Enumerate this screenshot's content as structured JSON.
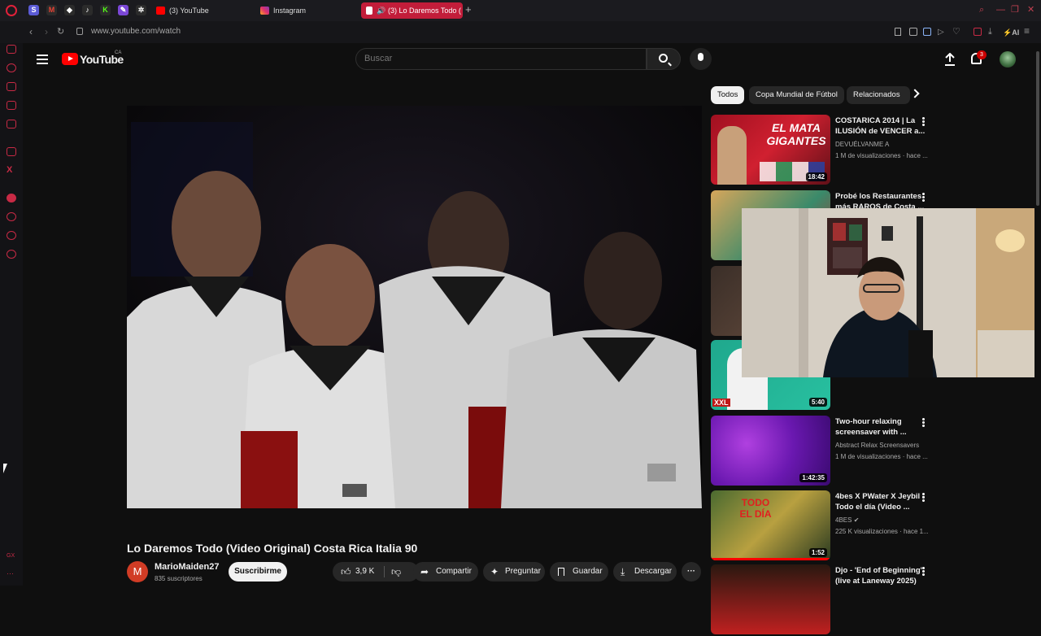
{
  "browser": {
    "tabs": [
      {
        "label": "(3) YouTube",
        "active": false
      },
      {
        "label": "Instagram",
        "active": false
      },
      {
        "label": "(3) Lo Daremos Todo (",
        "active": true
      }
    ],
    "url": "www.youtube.com/watch",
    "brand_color": "#c21d3a"
  },
  "header": {
    "logo_text": "YouTube",
    "region": "CA",
    "search_placeholder": "Buscar",
    "notification_count": "3"
  },
  "video": {
    "title": "Lo Daremos Todo (Video Original) Costa Rica Italia 90",
    "channel": {
      "avatar_letter": "M",
      "name": "MarioMaiden27",
      "subscribers": "835 suscriptores"
    },
    "subscribe_label": "Suscribirme",
    "like_count": "3,9 K",
    "actions": {
      "share": "Compartir",
      "ask": "Preguntar",
      "save": "Guardar",
      "download": "Descargar"
    }
  },
  "chips": [
    "Todos",
    "Copa Mundial de Fútbol",
    "Relacionados"
  ],
  "recommendations": [
    {
      "title": "COSTARICA 2014 | La ILUSIÓN de VENCER a...",
      "channel": "DEVUÉLVANME A",
      "meta": "1 M de visualizaciones · hace ...",
      "duration": "18:42",
      "thumb_text": "EL MATA GIGANTES"
    },
    {
      "title": "Probé los Restaurantes más RAROS de Costa ...",
      "channel": "",
      "meta": "",
      "duration": ""
    },
    {
      "title": "",
      "channel": "",
      "meta": "",
      "duration": ""
    },
    {
      "title": "",
      "channel": "",
      "meta": "",
      "duration": "5:40",
      "thumb_text": "XXL"
    },
    {
      "title": "Two-hour relaxing screensaver with ...",
      "channel": "Abstract Relax Screensavers",
      "meta": "1 M de visualizaciones · hace ...",
      "duration": "1:42:35"
    },
    {
      "title": "4bes X PWater X Jeybil - Todo el día (Video ...",
      "channel": "4BES",
      "meta": "225 K visualizaciones · hace 1...",
      "duration": "1:52",
      "thumb_text": "TODO EL DÍA"
    },
    {
      "title": "Djo - 'End of Beginning' (live at Laneway 2025)",
      "channel": "",
      "meta": "",
      "duration": ""
    }
  ]
}
